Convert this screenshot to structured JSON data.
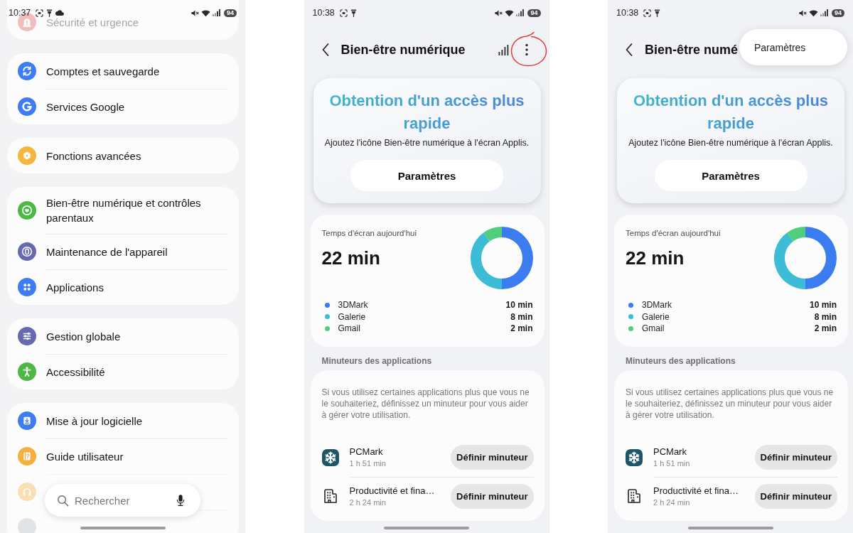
{
  "screens": [
    {
      "kind": "settings",
      "status_bar": {
        "time": "10:37",
        "left_icons": [
          {
            "kind": "screenshot"
          },
          {
            "kind": "pin"
          },
          {
            "kind": "cloud"
          }
        ],
        "right_icons": [
          {
            "kind": "mute"
          },
          {
            "kind": "wifi"
          },
          {
            "kind": "signal"
          }
        ],
        "battery": "94"
      },
      "groups": [
        {
          "items": [
            {
              "kind": "security",
              "label": "Sécurité et urgence",
              "faded": true
            }
          ]
        },
        {
          "items": [
            {
              "kind": "sync",
              "label": "Comptes et sauvegarde",
              "faded": false
            },
            {
              "kind": "google",
              "label": "Services Google",
              "faded": false
            }
          ]
        },
        {
          "items": [
            {
              "kind": "gear",
              "label": "Fonctions avancées",
              "faded": false
            }
          ]
        },
        {
          "items": [
            {
              "kind": "heart",
              "label": "Bien-être numérique et contrôles parentaux",
              "faded": false
            },
            {
              "kind": "maintenance",
              "label": "Maintenance de l'appareil",
              "faded": false
            },
            {
              "kind": "apps",
              "label": "Applications",
              "faded": false
            }
          ]
        },
        {
          "items": [
            {
              "kind": "sliders",
              "label": "Gestion globale",
              "faded": false
            },
            {
              "kind": "accessibility",
              "label": "Accessibilité",
              "faded": false
            }
          ]
        },
        {
          "items": [
            {
              "kind": "update",
              "label": "Mise à jour logicielle",
              "faded": false
            },
            {
              "kind": "guide",
              "label": "Guide utilisateur",
              "faded": false
            },
            {
              "kind": "headset",
              "faded": true
            },
            {
              "kind": "blank",
              "faded": true
            }
          ]
        }
      ],
      "search": {
        "placeholder": "Rechercher"
      }
    },
    {
      "kind": "wellbeing",
      "status_bar": {
        "time": "10:38",
        "left_icons": [
          {
            "kind": "screenshot"
          },
          {
            "kind": "pin"
          }
        ],
        "right_icons": [
          {
            "kind": "mute"
          },
          {
            "kind": "wifi"
          },
          {
            "kind": "signal"
          }
        ],
        "battery": "94"
      },
      "header": {
        "title": "Bien-être numérique",
        "actions": [
          {
            "kind": "stats"
          },
          {
            "kind": "more",
            "highlighted": true
          }
        ]
      },
      "promo": {
        "title": "Obtention d'un accès plus rapide",
        "text": "Ajoutez l'icône Bien-être numérique à l'écran Applis.",
        "button": "Paramètres"
      },
      "screen_time": {
        "label": "Temps d'écran aujourd'hui",
        "total": "22 min",
        "chart_data": {
          "type": "donut",
          "categories": [
            "3DMark",
            "Galerie",
            "Gmail"
          ],
          "values": [
            50,
            40,
            10
          ]
        },
        "legend": [
          {
            "value": "10 min",
            "color": "#3b7cf1"
          },
          {
            "value": "8 min",
            "color": "#3dbcd7"
          },
          {
            "value": "2 min",
            "color": "#4fcf7b"
          }
        ]
      },
      "timers": {
        "heading": "Minuteurs des applications",
        "description": "Si vous utilisez certaines applications plus que vous ne le souhaiteriez, définissez un minuteur pour vous aider à gérer votre utilisation.",
        "apps": [
          {
            "kind": "snowflake",
            "name": "PCMark",
            "usage": "1 h 51 min",
            "button": "Définir minuteur"
          },
          {
            "kind": "building",
            "name": "Productivité et fina…",
            "usage": "2 h 24 min",
            "button": "Définir minuteur"
          }
        ]
      }
    },
    {
      "kind": "wellbeing",
      "status_bar": {
        "time": "10:38",
        "left_icons": [
          {
            "kind": "screenshot"
          },
          {
            "kind": "pin"
          }
        ],
        "right_icons": [
          {
            "kind": "mute"
          },
          {
            "kind": "wifi"
          },
          {
            "kind": "signal"
          }
        ],
        "battery": "94"
      },
      "header": {
        "title": "Bien-être numé"
      },
      "menu": {
        "items": [
          {
            "label": "Paramètres"
          }
        ]
      },
      "promo": {
        "title": "Obtention d'un accès plus rapide",
        "text": "Ajoutez l'icône Bien-être numérique à l'écran Applis.",
        "button": "Paramètres"
      },
      "screen_time": {
        "label": "Temps d'écran aujourd'hui",
        "total": "22 min",
        "chart_data": {
          "type": "donut",
          "categories": [
            "3DMark",
            "Galerie",
            "Gmail"
          ],
          "values": [
            50,
            40,
            10
          ]
        },
        "legend": [
          {
            "value": "10 min",
            "color": "#3b7cf1"
          },
          {
            "value": "8 min",
            "color": "#3dbcd7"
          },
          {
            "value": "2 min",
            "color": "#4fcf7b"
          }
        ]
      },
      "timers": {
        "heading": "Minuteurs des applications",
        "description": "Si vous utilisez certaines applications plus que vous ne le souhaiteriez, définissez un minuteur pour vous aider à gérer votre utilisation.",
        "apps": [
          {
            "kind": "snowflake",
            "name": "PCMark",
            "usage": "1 h 51 min",
            "button": "Définir minuteur"
          },
          {
            "kind": "building",
            "name": "Productivité et fina…",
            "usage": "2 h 24 min",
            "button": "Définir minuteur"
          }
        ]
      }
    }
  ]
}
